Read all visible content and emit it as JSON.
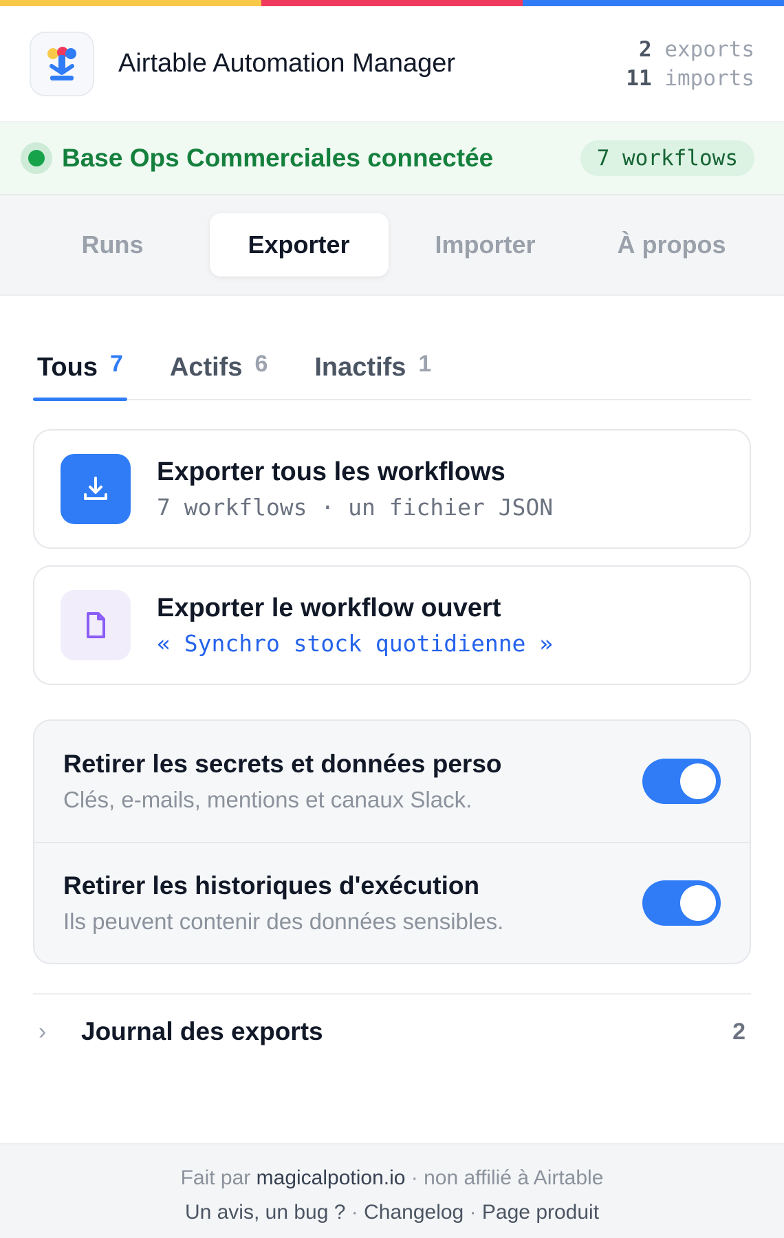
{
  "colors": {
    "stripe": [
      "#f8c848",
      "#ef3a5d",
      "#2f7cf6"
    ],
    "accent": "#2f7cf6",
    "success": "#16a34a"
  },
  "header": {
    "title": "Airtable Automation Manager",
    "exports_count": "2",
    "exports_label": "exports",
    "imports_count": "11",
    "imports_label": "imports"
  },
  "status": {
    "text": "Base Ops Commerciales connectée",
    "badge": "7 workflows"
  },
  "nav": {
    "tabs": [
      "Runs",
      "Exporter",
      "Importer",
      "À propos"
    ],
    "active": 1
  },
  "filters": {
    "tabs": [
      {
        "label": "Tous",
        "count": "7"
      },
      {
        "label": "Actifs",
        "count": "6"
      },
      {
        "label": "Inactifs",
        "count": "1"
      }
    ],
    "active": 0
  },
  "export_all": {
    "title": "Exporter tous les workflows",
    "subtitle": "7 workflows · un fichier JSON",
    "icon": "download-icon"
  },
  "export_open": {
    "title": "Exporter le workflow ouvert",
    "subtitle": "« Synchro stock quotidienne »",
    "icon": "file-icon"
  },
  "options": [
    {
      "title": "Retirer les secrets et données perso",
      "desc": "Clés, e-mails, mentions et canaux Slack.",
      "enabled": true
    },
    {
      "title": "Retirer les historiques d'exécution",
      "desc": "Ils peuvent contenir des données sensibles.",
      "enabled": true
    }
  ],
  "journal": {
    "title": "Journal des exports",
    "count": "2"
  },
  "footer": {
    "made_by": "Fait par",
    "brand": "magicalpotion.io",
    "not_affiliated": "· non affilié à Airtable",
    "feedback": "Un avis, un bug ?",
    "sep": "·",
    "changelog": "Changelog",
    "product_page": "Page produit"
  }
}
